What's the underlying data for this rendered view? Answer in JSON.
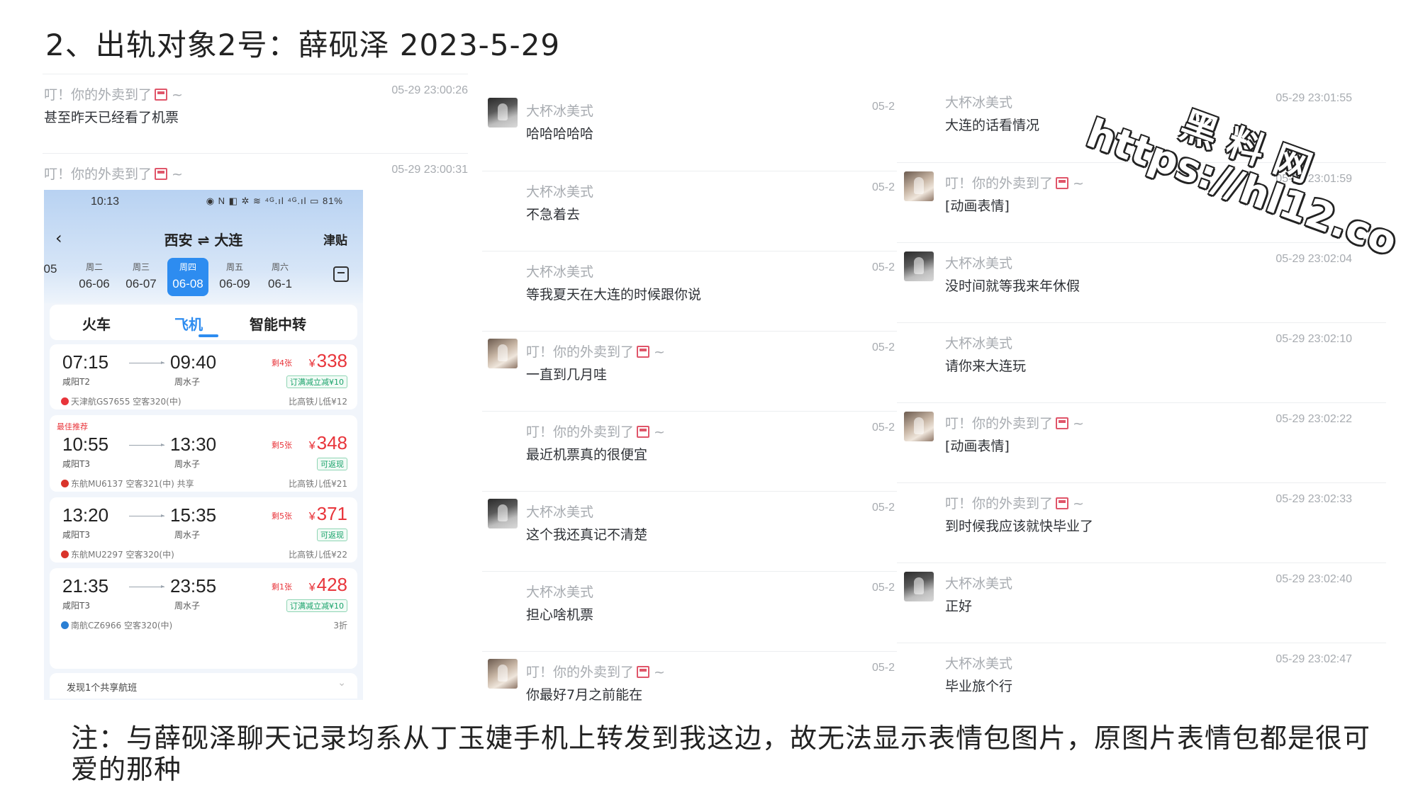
{
  "title": "2、出轨对象2号：薛砚泽  2023-5-29",
  "note": "注：与薛砚泽聊天记录均系从丁玉婕手机上转发到我这边，故无法显示表情包图片，原图片表情包都是很可爱的那种",
  "watermark": {
    "name": "黑料网",
    "url": "https://hl12.co"
  },
  "chat_left": [
    {
      "sender": "叮！你的外卖到了",
      "icon": "takeout-box-icon",
      "tilde": "~",
      "time": "05-29 23:00:26",
      "text": "甚至昨天已经看了机票"
    },
    {
      "sender": "叮！你的外卖到了",
      "icon": "takeout-box-icon",
      "tilde": "~",
      "time": "05-29 23:00:31",
      "text": ""
    }
  ],
  "chat_middle": [
    {
      "sender": "大杯冰美式",
      "avatar": "dark",
      "time": "05-2",
      "text": "哈哈哈哈哈"
    },
    {
      "sender": "大杯冰美式",
      "avatar": "",
      "time": "05-2",
      "text": "不急着去"
    },
    {
      "sender": "大杯冰美式",
      "avatar": "",
      "time": "05-2",
      "text": "等我夏天在大连的时候跟你说"
    },
    {
      "sender": "叮！你的外卖到了",
      "icon": true,
      "tilde": "~",
      "avatar": "light",
      "time": "05-2",
      "text": "一直到几月哇"
    },
    {
      "sender": "叮！你的外卖到了",
      "icon": true,
      "tilde": "~",
      "avatar": "",
      "time": "05-2",
      "text": "最近机票真的很便宜"
    },
    {
      "sender": "大杯冰美式",
      "avatar": "dark",
      "time": "05-2",
      "text": "这个我还真记不清楚"
    },
    {
      "sender": "大杯冰美式",
      "avatar": "",
      "time": "05-2",
      "text": "担心啥机票"
    },
    {
      "sender": "叮！你的外卖到了",
      "icon": true,
      "tilde": "~",
      "avatar": "light",
      "time": "05-2",
      "text": "你最好7月之前能在"
    }
  ],
  "chat_right": [
    {
      "sender": "大杯冰美式",
      "avatar": "",
      "time": "05-29 23:01:55",
      "text": "大连的话看情况"
    },
    {
      "sender": "叮！你的外卖到了",
      "icon": true,
      "tilde": "~",
      "avatar": "light",
      "time": "05-29 23:01:59",
      "text": "[动画表情]"
    },
    {
      "sender": "大杯冰美式",
      "avatar": "dark",
      "time": "05-29 23:02:04",
      "text": "没时间就等我来年休假"
    },
    {
      "sender": "大杯冰美式",
      "avatar": "",
      "time": "05-29 23:02:10",
      "text": "请你来大连玩"
    },
    {
      "sender": "叮！你的外卖到了",
      "icon": true,
      "tilde": "~",
      "avatar": "light",
      "time": "05-29 23:02:22",
      "text": "[动画表情]"
    },
    {
      "sender": "叮！你的外卖到了",
      "icon": true,
      "tilde": "~",
      "avatar": "",
      "time": "05-29 23:02:33",
      "text": "到时候我应该就快毕业了"
    },
    {
      "sender": "大杯冰美式",
      "avatar": "dark",
      "time": "05-29 23:02:40",
      "text": "正好"
    },
    {
      "sender": "大杯冰美式",
      "avatar": "",
      "time": "05-29 23:02:47",
      "text": "毕业旅个行"
    }
  ],
  "phone": {
    "status_time": "10:13",
    "status_icons": "◉ N ◧ ✲ ≋ ⁴ᴳ.ıl ⁴ᴳ.ıl ▭ 81%",
    "route": "西安 ⇌ 大连",
    "subsidy": "津贴",
    "dates": [
      {
        "weekday": "",
        "date": "05",
        "active": false
      },
      {
        "weekday": "周二",
        "date": "06-06",
        "active": false
      },
      {
        "weekday": "周三",
        "date": "06-07",
        "active": false
      },
      {
        "weekday": "周四",
        "date": "06-08",
        "active": true
      },
      {
        "weekday": "周五",
        "date": "06-09",
        "active": false
      },
      {
        "weekday": "周六",
        "date": "06-1",
        "active": false
      }
    ],
    "modes": [
      "火车",
      "飞机",
      "智能中转"
    ],
    "active_mode": "飞机",
    "flights": [
      {
        "dep": "07:15",
        "arr": "09:40",
        "dep_ap": "咸阳T2",
        "arr_ap": "周水子",
        "seats": "剩4张",
        "price": "338",
        "tag": "订满减立减¥10",
        "airline": "天津航GS7655 空客320(中)",
        "logo": "#e8353b",
        "extra": "比高铁儿低¥12",
        "best": ""
      },
      {
        "dep": "10:55",
        "arr": "13:30",
        "dep_ap": "咸阳T3",
        "arr_ap": "周水子",
        "seats": "剩5张",
        "price": "348",
        "tag": "可返现",
        "airline": "东航MU6137 空客321(中)  共享",
        "logo": "#d9342b",
        "extra": "比高铁儿低¥21",
        "best": "最佳推荐"
      },
      {
        "dep": "13:20",
        "arr": "15:35",
        "dep_ap": "咸阳T3",
        "arr_ap": "周水子",
        "seats": "剩5张",
        "price": "371",
        "tag": "可返现",
        "airline": "东航MU2297 空客320(中)",
        "logo": "#d9342b",
        "extra": "比高铁儿低¥22",
        "best": ""
      },
      {
        "dep": "21:35",
        "arr": "23:55",
        "dep_ap": "咸阳T3",
        "arr_ap": "周水子",
        "seats": "剩1张",
        "price": "428",
        "tag": "订满减立减¥10",
        "airline": "南航CZ6966 空客320(中)",
        "logo": "#2a7fd4",
        "extra": "3折",
        "best": ""
      }
    ],
    "currency": "¥",
    "share_bar": "发现1个共享航班"
  }
}
